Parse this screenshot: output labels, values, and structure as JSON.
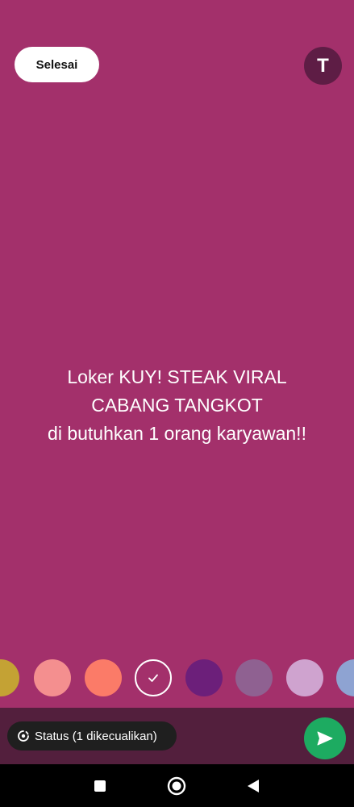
{
  "header": {
    "done_label": "Selesai",
    "font_button_label": "T"
  },
  "status": {
    "lines": [
      "Loker KUY! STEAK VIRAL",
      "CABANG TANGKOT",
      "di butuhkan 1 orang karyawan!!"
    ],
    "background_color": "#a3306b"
  },
  "palette": {
    "colors": [
      "#c4a234",
      "#f48f8f",
      "#fb7b68",
      "#a3306b",
      "#6c1f7a",
      "#8f6191",
      "#cfa3cf",
      "#8ea3d2"
    ],
    "selected_index": 3
  },
  "footer": {
    "audience_label": "Status (1 dikecualikan)",
    "send_color": "#1dab61"
  },
  "icons": {
    "audience": "status-ring-icon",
    "send": "send-icon",
    "nav_recent": "square-icon",
    "nav_home": "circle-icon",
    "nav_back": "triangle-back-icon"
  }
}
